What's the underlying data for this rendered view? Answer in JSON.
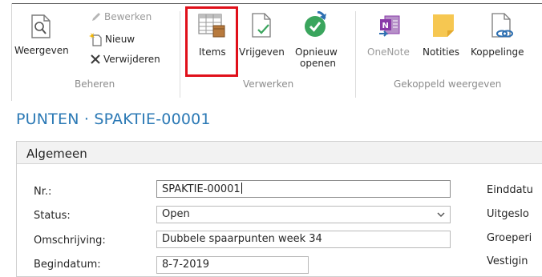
{
  "ribbon": {
    "groups": {
      "beheren": "Beheren",
      "verwerken": "Verwerken",
      "gekoppeld": "Gekoppeld weergeven"
    },
    "buttons": {
      "weergeven": "Weergeven",
      "bewerken": "Bewerken",
      "nieuw": "Nieuw",
      "verwijderen": "Verwijderen",
      "items": "Items",
      "vrijgeven": "Vrijgeven",
      "opnieuw_line1": "Opnieuw",
      "opnieuw_line2": "openen",
      "onenote": "OneNote",
      "notities": "Notities",
      "koppelingen": "Koppelinge"
    },
    "colors": {
      "highlight": "#e0101a",
      "onenote": "#8a3aa8",
      "notes": "#f6c751",
      "reopen": "#3aa55d",
      "link": "#2d6fb1"
    }
  },
  "page": {
    "title": "PUNTEN · SPAKTIE-00001"
  },
  "card": {
    "header": "Algemeen",
    "fields": {
      "nr_label": "Nr.:",
      "nr_value": "SPAKTIE-00001",
      "status_label": "Status:",
      "status_value": "Open",
      "omschrijving_label": "Omschrijving:",
      "omschrijving_value": "Dubbele spaarpunten week 34",
      "beginlabel": "Begindatum:",
      "beginvalue": "8-7-2019"
    },
    "right_labels": {
      "eind": "Einddatu",
      "uitgesl": "Uitgeslo",
      "groep": "Groeperi",
      "vestiging": "Vestigin"
    }
  }
}
